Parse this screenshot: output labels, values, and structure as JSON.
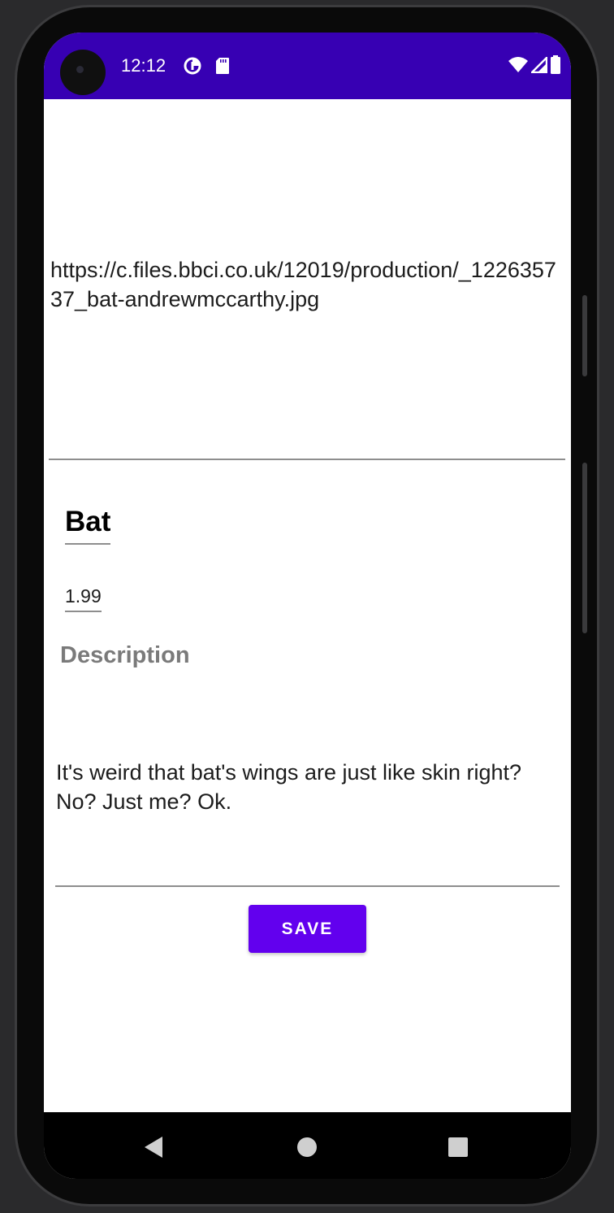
{
  "status_bar": {
    "time": "12:12",
    "background_color": "#3700b3",
    "left_icons": [
      "data-saver-icon",
      "sd-card-icon"
    ],
    "right_icons": [
      "wifi-icon",
      "cell-signal-icon",
      "battery-icon"
    ]
  },
  "form": {
    "image_url": "https://c.files.bbci.co.uk/12019/production/_122635737_bat-andrewmccarthy.jpg",
    "name": "Bat",
    "price": "1.99",
    "description_label": "Description",
    "description": "It's weird that bat's wings are just like skin right? No? Just me? Ok."
  },
  "actions": {
    "save_label": "SAVE",
    "accent_color": "#6200ee"
  },
  "nav_bar": {
    "buttons": [
      "back-icon",
      "home-icon",
      "recents-icon"
    ]
  }
}
